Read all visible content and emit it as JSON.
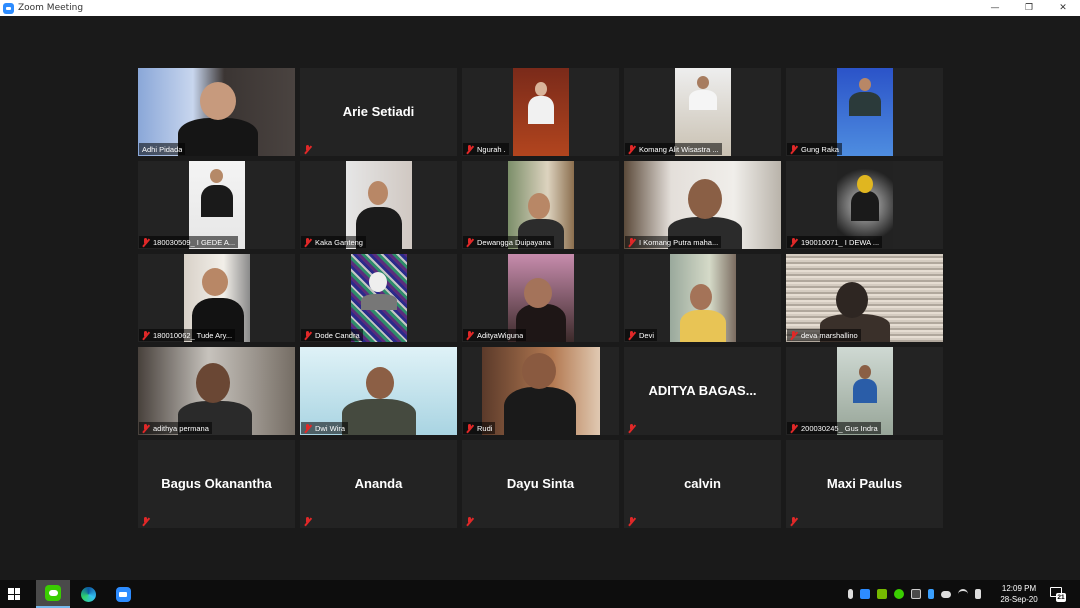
{
  "window": {
    "title": "Zoom Meeting",
    "controls": [
      "—",
      "❐",
      "✕"
    ]
  },
  "participants": [
    {
      "name": "Adhi Pidada",
      "video": true,
      "muted": false
    },
    {
      "name": "Arie Setiadi",
      "video": false,
      "muted": true
    },
    {
      "name": "Ngurah .",
      "video": true,
      "muted": true
    },
    {
      "name": "Komang Alit Wisastra ...",
      "video": true,
      "muted": true
    },
    {
      "name": "Gung Raka",
      "video": true,
      "muted": true
    },
    {
      "name": "180030509_ I GEDE A...",
      "video": true,
      "muted": true
    },
    {
      "name": "Kaka Ganteng",
      "video": true,
      "muted": true
    },
    {
      "name": "Dewangga Duipayana",
      "video": true,
      "muted": true
    },
    {
      "name": "I Komang Putra maha...",
      "video": true,
      "muted": true,
      "active_speaker": true
    },
    {
      "name": "190010071_ I DEWA ...",
      "video": true,
      "muted": true
    },
    {
      "name": "180010062_ Tude Ary...",
      "video": true,
      "muted": true
    },
    {
      "name": "Dode Candra",
      "video": true,
      "muted": true
    },
    {
      "name": "AdityaWiguna",
      "video": true,
      "muted": true
    },
    {
      "name": "Devi",
      "video": true,
      "muted": true
    },
    {
      "name": "deva marshallino",
      "video": true,
      "muted": true
    },
    {
      "name": "adithya permana",
      "video": true,
      "muted": true
    },
    {
      "name": "Dwi Wira",
      "video": true,
      "muted": true
    },
    {
      "name": "Rudi",
      "video": true,
      "muted": true
    },
    {
      "name": "ADITYA BAGAS...",
      "video": false,
      "muted": true
    },
    {
      "name": "200030245_ Gus Indra",
      "video": true,
      "muted": true
    },
    {
      "name": "Bagus Okanantha",
      "video": false,
      "muted": true
    },
    {
      "name": "Ananda",
      "video": false,
      "muted": true
    },
    {
      "name": "Dayu Sinta",
      "video": false,
      "muted": true
    },
    {
      "name": "calvin",
      "video": false,
      "muted": true
    },
    {
      "name": "Maxi Paulus",
      "video": false,
      "muted": true
    }
  ],
  "taskbar": {
    "apps": [
      "line-icon",
      "edge-icon",
      "zoom-icon"
    ],
    "clock": {
      "time": "12:09 PM",
      "date": "28-Sep-20"
    },
    "notifications_count": "21"
  },
  "colors": {
    "active_speaker_border": "#b5e61d",
    "muted_red": "#e02828",
    "zoom_blue": "#2D8CFF"
  }
}
